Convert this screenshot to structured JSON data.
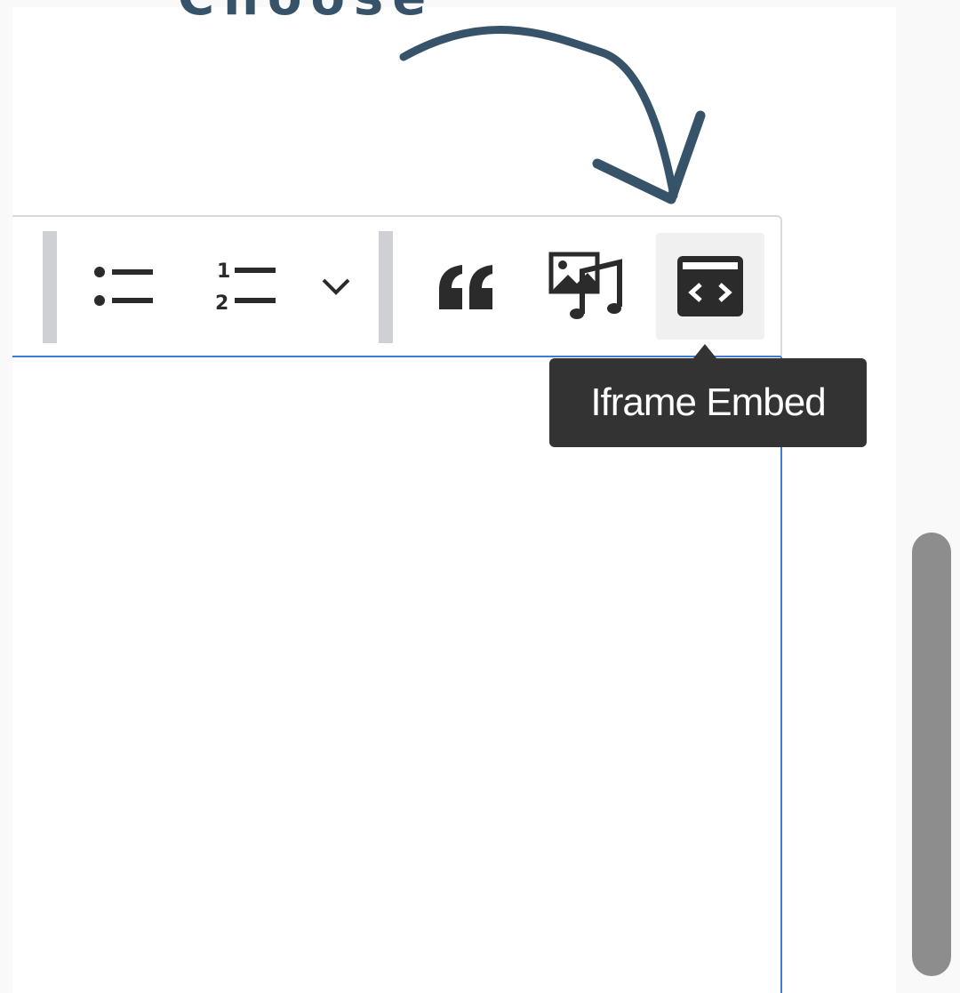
{
  "annotation": {
    "label": "Choose",
    "color": "#365369"
  },
  "toolbar": {
    "buttons": [
      {
        "name": "bulleted-list",
        "icon": "bulleted-list-icon"
      },
      {
        "name": "numbered-list",
        "icon": "numbered-list-icon"
      },
      {
        "name": "list-options",
        "icon": "chevron-down-icon"
      },
      {
        "name": "blockquote",
        "icon": "quote-icon"
      },
      {
        "name": "media-embed",
        "icon": "image-music-icon"
      },
      {
        "name": "iframe-embed",
        "icon": "iframe-embed-icon",
        "active": true
      }
    ]
  },
  "tooltip": {
    "text": "Iframe Embed"
  },
  "colors": {
    "accent": "#3f7bd0",
    "tooltip_bg": "#333333",
    "icon": "#2b2b2b"
  }
}
